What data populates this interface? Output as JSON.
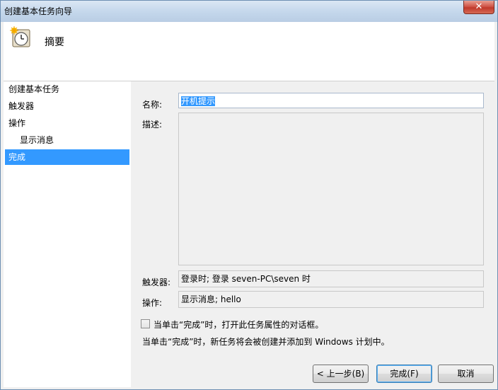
{
  "window": {
    "title": "创建基本任务向导",
    "close_label": "✕"
  },
  "header": {
    "title": "摘要",
    "icon": "task-clock-icon"
  },
  "sidebar": {
    "items": [
      {
        "label": "创建基本任务"
      },
      {
        "label": "触发器"
      },
      {
        "label": "操作"
      },
      {
        "label": "显示消息"
      },
      {
        "label": "完成"
      }
    ]
  },
  "summary": {
    "name_label": "名称:",
    "name_value": "开机提示",
    "desc_label": "描述:",
    "desc_value": "",
    "trigger_label": "触发器:",
    "trigger_value": "登录时; 登录 seven-PC\\seven 时",
    "action_label": "操作:",
    "action_value": "显示消息; hello"
  },
  "options": {
    "open_props_label": "当单击“完成”时，打开此任务属性的对话框。",
    "open_props_checked": false,
    "note": "当单击“完成”时，新任务将会被创建并添加到 Windows 计划中。"
  },
  "buttons": {
    "back": "< 上一步(B)",
    "finish": "完成(F)",
    "cancel": "取消"
  }
}
